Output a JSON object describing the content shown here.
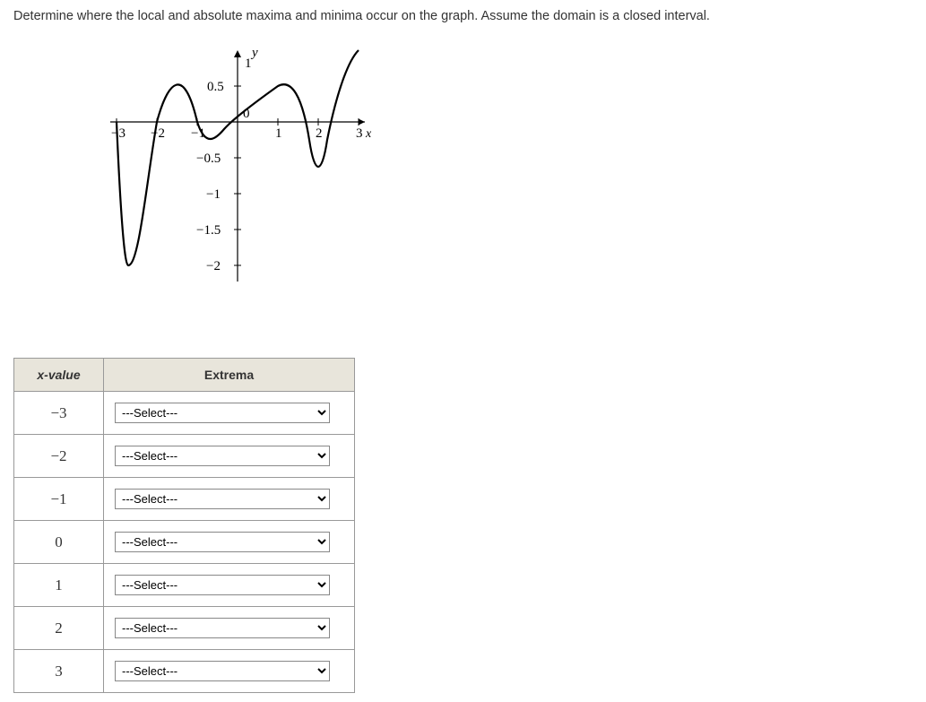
{
  "question": "Determine where the local and absolute maxima and minima occur on the graph. Assume the domain is a closed interval.",
  "chart_data": {
    "type": "line",
    "title": "",
    "xlabel": "x",
    "ylabel": "y",
    "xlim": [
      -3.3,
      3.3
    ],
    "ylim": [
      -2.2,
      1.2
    ],
    "xticks": [
      -3,
      -2,
      -1,
      0,
      1,
      2,
      3
    ],
    "yticks": [
      -2,
      -1.5,
      -1,
      -0.5,
      0.5,
      1
    ],
    "x": [
      -3,
      -2.7,
      -2.3,
      -2,
      -1.7,
      -1.5,
      -1.3,
      -1,
      -0.6,
      -0.3,
      0,
      0.3,
      0.6,
      1,
      1.3,
      1.6,
      1.8,
      2,
      2.2,
      2.5,
      2.7,
      3
    ],
    "y": [
      0,
      -2,
      -1.5,
      0,
      0.7,
      0.8,
      0.7,
      0,
      -0.3,
      -0.15,
      0,
      0.2,
      0.4,
      0.5,
      0.35,
      0,
      -0.4,
      -0.7,
      -0.4,
      0.3,
      0.8,
      1
    ],
    "description": "Curve on closed interval [-3,3] with approximate local min near x=-2.7, local max near x=-1.5, local min near x=-0.6, local max near x=1, local min near x=2, rising to endpoint x=3 at y=1"
  },
  "table": {
    "headers": {
      "x": "x-value",
      "ext": "Extrema"
    },
    "placeholder": "---Select---",
    "rows": [
      {
        "x": "−3",
        "value": "---Select---"
      },
      {
        "x": "−2",
        "value": "---Select---"
      },
      {
        "x": "−1",
        "value": "---Select---"
      },
      {
        "x": "0",
        "value": "---Select---"
      },
      {
        "x": "1",
        "value": "---Select---"
      },
      {
        "x": "2",
        "value": "---Select---"
      },
      {
        "x": "3",
        "value": "---Select---"
      }
    ]
  }
}
